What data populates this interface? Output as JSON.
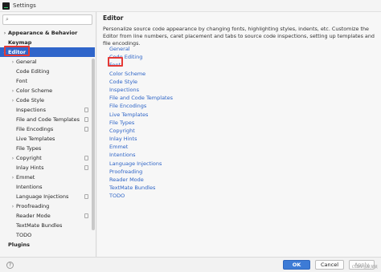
{
  "window": {
    "title": "Settings"
  },
  "sidebar": {
    "search_placeholder": "",
    "items": [
      {
        "label": "Appearance & Behavior",
        "level": 0,
        "bold": true,
        "arrow": "›"
      },
      {
        "label": "Keymap",
        "level": 0,
        "bold": true,
        "arrow": ""
      },
      {
        "label": "Editor",
        "level": 0,
        "bold": true,
        "arrow": "⌄",
        "selected": true
      },
      {
        "label": "General",
        "level": 1,
        "arrow": "›"
      },
      {
        "label": "Code Editing",
        "level": 1,
        "arrow": ""
      },
      {
        "label": "Font",
        "level": 1,
        "arrow": ""
      },
      {
        "label": "Color Scheme",
        "level": 1,
        "arrow": "›"
      },
      {
        "label": "Code Style",
        "level": 1,
        "arrow": "›"
      },
      {
        "label": "Inspections",
        "level": 1,
        "arrow": "",
        "project": true
      },
      {
        "label": "File and Code Templates",
        "level": 1,
        "arrow": "",
        "project": true
      },
      {
        "label": "File Encodings",
        "level": 1,
        "arrow": "",
        "project": true
      },
      {
        "label": "Live Templates",
        "level": 1,
        "arrow": ""
      },
      {
        "label": "File Types",
        "level": 1,
        "arrow": ""
      },
      {
        "label": "Copyright",
        "level": 1,
        "arrow": "›",
        "project": true
      },
      {
        "label": "Inlay Hints",
        "level": 1,
        "arrow": "",
        "project": true
      },
      {
        "label": "Emmet",
        "level": 1,
        "arrow": "›"
      },
      {
        "label": "Intentions",
        "level": 1,
        "arrow": ""
      },
      {
        "label": "Language Injections",
        "level": 1,
        "arrow": "",
        "project": true
      },
      {
        "label": "Proofreading",
        "level": 1,
        "arrow": "›"
      },
      {
        "label": "Reader Mode",
        "level": 1,
        "arrow": "",
        "project": true
      },
      {
        "label": "TextMate Bundles",
        "level": 1,
        "arrow": ""
      },
      {
        "label": "TODO",
        "level": 1,
        "arrow": ""
      },
      {
        "label": "Plugins",
        "level": 0,
        "bold": true,
        "arrow": ""
      }
    ]
  },
  "main": {
    "title": "Editor",
    "description": "Personalize source code appearance by changing fonts, highlighting styles, indents, etc. Customize the Editor from line numbers, caret placement and tabs to source code inspections, setting up templates and file encodings.",
    "links": [
      "General",
      "Code Editing",
      "Font",
      "Color Scheme",
      "Code Style",
      "Inspections",
      "File and Code Templates",
      "File Encodings",
      "Live Templates",
      "File Types",
      "Copyright",
      "Inlay Hints",
      "Emmet",
      "Intentions",
      "Language Injections",
      "Proofreading",
      "Reader Mode",
      "TextMate Bundles",
      "TODO"
    ]
  },
  "footer": {
    "help": "?",
    "ok_label": "OK",
    "cancel_label": "Cancel",
    "apply_label": "Apply"
  },
  "watermark": "CSDN @某某某",
  "colors": {
    "selection": "#2f65ca",
    "link": "#2c63c6",
    "highlight": "#e53935",
    "ok_button": "#3d7bd6"
  }
}
